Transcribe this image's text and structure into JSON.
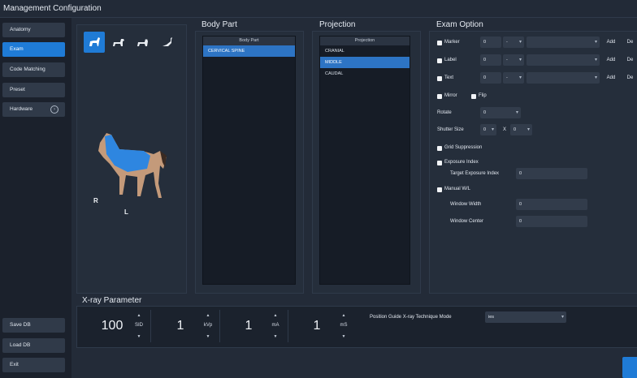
{
  "window": {
    "title": "Management Configuration"
  },
  "sidebar": {
    "top_items": [
      {
        "label": "Anatomy",
        "active": false
      },
      {
        "label": "Exam",
        "active": true
      },
      {
        "label": "Code Matching",
        "active": false
      },
      {
        "label": "Preset",
        "active": false
      },
      {
        "label": "Hardware",
        "active": false,
        "icon": "info-circle-icon"
      }
    ],
    "bottom_items": [
      {
        "label": "Save DB"
      },
      {
        "label": "Load DB"
      },
      {
        "label": "Exit"
      }
    ]
  },
  "species": {
    "items": [
      "horse-icon",
      "dog-icon",
      "cat-icon",
      "bird-icon"
    ],
    "selected": "horse-icon"
  },
  "preview": {
    "right_marker": "R",
    "left_marker": "L"
  },
  "body_part": {
    "title": "Body Part",
    "header": "Body Part",
    "items": [
      "CERVICAL SPINE"
    ],
    "selected_index": 0
  },
  "projection": {
    "title": "Projection",
    "header": "Projection",
    "items": [
      "CRANIAL",
      "MIDDLE",
      "CAUDAL"
    ],
    "selected_index": 1
  },
  "exam_option": {
    "title": "Exam Option",
    "marker": {
      "label": "Marker",
      "value": "0",
      "dash": "-",
      "add": "Add",
      "del": "De"
    },
    "label": {
      "label": "Label",
      "value": "0",
      "dash": "-",
      "add": "Add",
      "del": "De"
    },
    "text": {
      "label": "Text",
      "value": "0",
      "dash": "-",
      "add": "Add",
      "del": "De"
    },
    "mirror": "Mirror",
    "flip": "Flip",
    "rotate": {
      "label": "Rotate",
      "value": "0"
    },
    "shutter": {
      "label": "Shutter Size",
      "w": "0",
      "x": "X",
      "h": "0"
    },
    "grid_suppression": "Grid Suppression",
    "exposure_index": "Exposure Index",
    "target_exposure": {
      "label": "Target Exposure Index",
      "value": "0"
    },
    "manual_wl": "Manual W/L",
    "window_width": {
      "label": "Window Width",
      "value": "0"
    },
    "window_center": {
      "label": "Window Center",
      "value": "0"
    }
  },
  "xray": {
    "title": "X-ray Parameter",
    "params": [
      {
        "value": "100",
        "unit": "SID"
      },
      {
        "value": "1",
        "unit": "kVp"
      },
      {
        "value": "1",
        "unit": "mA"
      },
      {
        "value": "1",
        "unit": "mS"
      }
    ],
    "arrow_up": "▲",
    "arrow_down": "▼",
    "technique_label": "Position Guide X-ray Technique Mode",
    "technique_value": "ies"
  },
  "colors": {
    "accent": "#1f7bd6",
    "panel": "#252e3b",
    "list_bg": "#161c26",
    "horse_cover": "#2e86e0"
  }
}
